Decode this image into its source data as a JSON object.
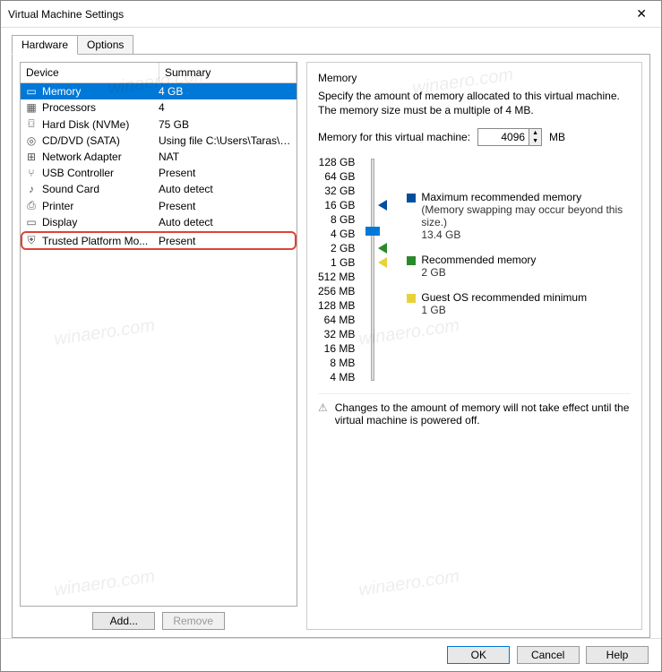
{
  "window": {
    "title": "Virtual Machine Settings"
  },
  "tabs": {
    "hardware": "Hardware",
    "options": "Options"
  },
  "headers": {
    "device": "Device",
    "summary": "Summary"
  },
  "devices": [
    {
      "icon": "▭",
      "name": "Memory",
      "summary": "4 GB",
      "selected": true
    },
    {
      "icon": "▦",
      "name": "Processors",
      "summary": "4"
    },
    {
      "icon": "⌼",
      "name": "Hard Disk (NVMe)",
      "summary": "75 GB"
    },
    {
      "icon": "◎",
      "name": "CD/DVD (SATA)",
      "summary": "Using file C:\\Users\\Taras\\Do..."
    },
    {
      "icon": "⊞",
      "name": "Network Adapter",
      "summary": "NAT"
    },
    {
      "icon": "⑂",
      "name": "USB Controller",
      "summary": "Present"
    },
    {
      "icon": "♪",
      "name": "Sound Card",
      "summary": "Auto detect"
    },
    {
      "icon": "⎙",
      "name": "Printer",
      "summary": "Present"
    },
    {
      "icon": "▭",
      "name": "Display",
      "summary": "Auto detect"
    },
    {
      "icon": "⛨",
      "name": "Trusted Platform Mo...",
      "summary": "Present",
      "highlight": true
    }
  ],
  "buttons": {
    "add": "Add...",
    "remove": "Remove",
    "ok": "OK",
    "cancel": "Cancel",
    "help": "Help"
  },
  "panel": {
    "title": "Memory",
    "desc": "Specify the amount of memory allocated to this virtual machine. The memory size must be a multiple of 4 MB.",
    "label": "Memory for this virtual machine:",
    "value": "4096",
    "unit": "MB",
    "ticks": [
      "128 GB",
      "64 GB",
      "32 GB",
      "16 GB",
      "8 GB",
      "4 GB",
      "2 GB",
      "1 GB",
      "512 MB",
      "256 MB",
      "128 MB",
      "64 MB",
      "32 MB",
      "16 MB",
      "8 MB",
      "4 MB"
    ],
    "legend": {
      "max": {
        "label": "Maximum recommended memory",
        "note": "(Memory swapping may occur beyond this size.)",
        "value": "13.4 GB"
      },
      "rec": {
        "label": "Recommended memory",
        "value": "2 GB"
      },
      "min": {
        "label": "Guest OS recommended minimum",
        "value": "1 GB"
      }
    },
    "warning": "Changes to the amount of memory will not take effect until the virtual machine is powered off."
  },
  "watermark": "winaero.com"
}
